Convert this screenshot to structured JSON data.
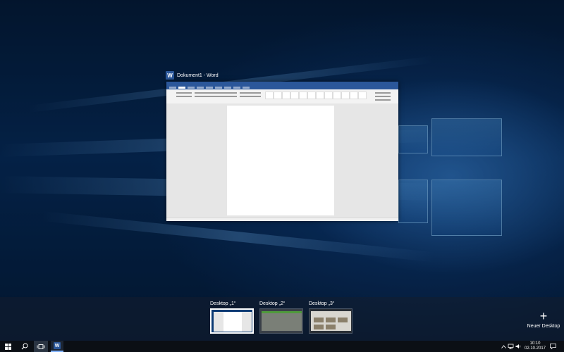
{
  "window": {
    "title": "Dokument1 - Word",
    "app_icon": "word-icon",
    "app_letter": "W",
    "accent": "#2b579a"
  },
  "desktops": [
    {
      "label": "Desktop „1“",
      "active": true
    },
    {
      "label": "Desktop „2“",
      "active": false
    },
    {
      "label": "Desktop „3“",
      "active": false
    }
  ],
  "new_desktop": {
    "label": "Neuer Desktop",
    "icon": "plus-icon"
  },
  "taskbar": {
    "start_icon": "windows-logo-icon",
    "search_icon": "search-icon",
    "task_view_icon": "task-view-icon",
    "pinned": [
      {
        "name": "word-taskbar-icon",
        "letter": "W",
        "active": true
      }
    ],
    "tray": {
      "chevron_icon": "chevron-up-icon",
      "network_icon": "network-icon",
      "volume_icon": "volume-icon",
      "notification_icon": "action-center-icon"
    },
    "clock": {
      "time": "10:10",
      "date": "02.10.2017"
    }
  }
}
